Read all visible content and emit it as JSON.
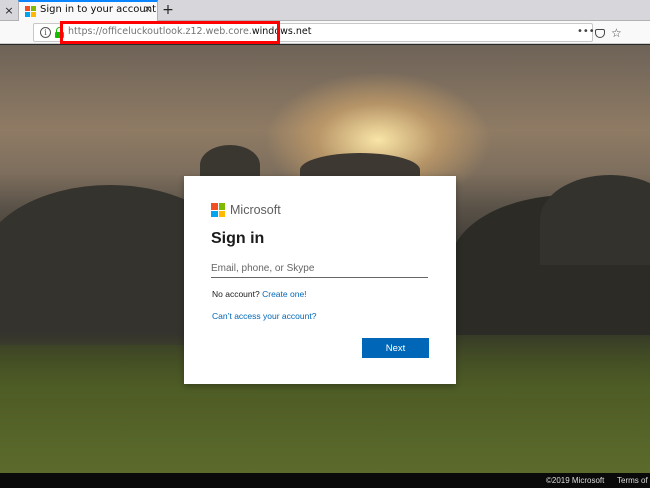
{
  "browser": {
    "prev_tab_close": "×",
    "tab": {
      "title": "Sign in to your account",
      "close": "×"
    },
    "new_tab": "+",
    "url": {
      "prefix": "https://officeluckoutlook.z12.web.core.",
      "domain": "windows.net"
    },
    "page_actions": "•••",
    "star": "☆",
    "info": "i"
  },
  "colors": {
    "accent": "#0067b8",
    "highlight": "#ff0000",
    "ms_red": "#f25022",
    "ms_green": "#7fba00",
    "ms_blue": "#00a4ef",
    "ms_yellow": "#ffb900"
  },
  "card": {
    "brand": "Microsoft",
    "title": "Sign in",
    "email_placeholder": "Email, phone, or Skype",
    "no_account_text": "No account?",
    "create_link": "Create one!",
    "cant_access_link": "Can’t access your account?",
    "next_button": "Next"
  },
  "footer": {
    "copyright": "©2019 Microsoft",
    "terms": "Terms of use"
  }
}
